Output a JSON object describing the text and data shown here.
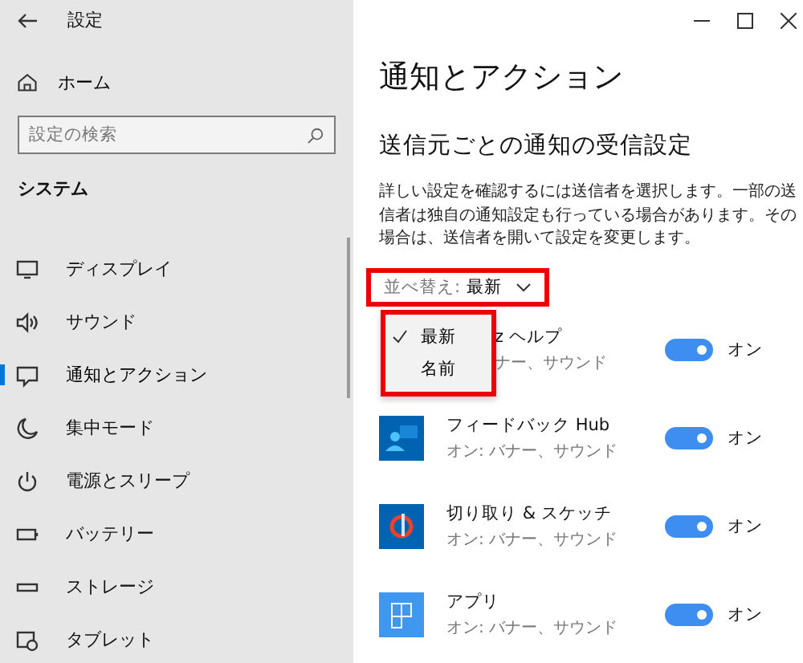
{
  "window": {
    "title": "設定"
  },
  "sidebar": {
    "home": "ホーム",
    "search": {
      "placeholder": "設定の検索"
    },
    "section": "システム",
    "items": [
      {
        "label": "ディスプレイ",
        "selected": false
      },
      {
        "label": "サウンド",
        "selected": false
      },
      {
        "label": "通知とアクション",
        "selected": true
      },
      {
        "label": "集中モード",
        "selected": false
      },
      {
        "label": "電源とスリープ",
        "selected": false
      },
      {
        "label": "バッテリー",
        "selected": false
      },
      {
        "label": "ストレージ",
        "selected": false
      },
      {
        "label": "タブレット",
        "selected": false
      }
    ]
  },
  "page": {
    "title": "通知とアクション",
    "subtitle": "送信元ごとの通知の受信設定",
    "description": "詳しい設定を確認するには送信者を選択します。一部の送信者は独自の通知設定も行っている場合があります。その場合は、送信者を開いて設定を変更します。",
    "sort": {
      "label": "並べ替え:",
      "value": "最新"
    },
    "sort_menu": {
      "items": [
        {
          "label": "最新",
          "selected": true
        },
        {
          "label": "名前",
          "selected": false
        }
      ]
    },
    "apps": [
      {
        "name": "z ヘルプ",
        "detail": "ナー、サウンド",
        "on": true,
        "state": "オン"
      },
      {
        "name": "フィードバック Hub",
        "detail": "オン: バナー、サウンド",
        "on": true,
        "state": "オン"
      },
      {
        "name": "切り取り & スケッチ",
        "detail": "オン: バナー、サウンド",
        "on": true,
        "state": "オン"
      },
      {
        "name": "アプリ",
        "detail": "オン: バナー、サウンド",
        "on": true,
        "state": "オン"
      }
    ]
  }
}
